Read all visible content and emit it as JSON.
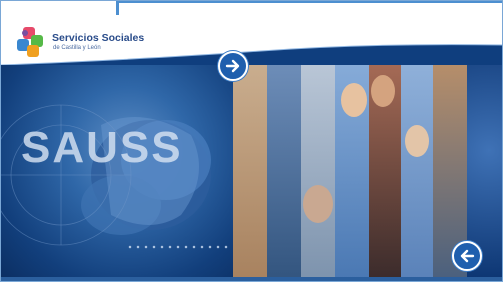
{
  "logo": {
    "title": "Servicios Sociales",
    "subtitle": "de Castilla y León"
  },
  "banner": {
    "text": "SAUSS"
  },
  "navigation": {
    "next_icon": "arrow-right-icon",
    "prev_icon": "arrow-left-icon"
  },
  "colors": {
    "brand_blue": "#2a4c8a",
    "banner_blue": "#0f3e7e",
    "button_blue": "#1f5fae"
  }
}
